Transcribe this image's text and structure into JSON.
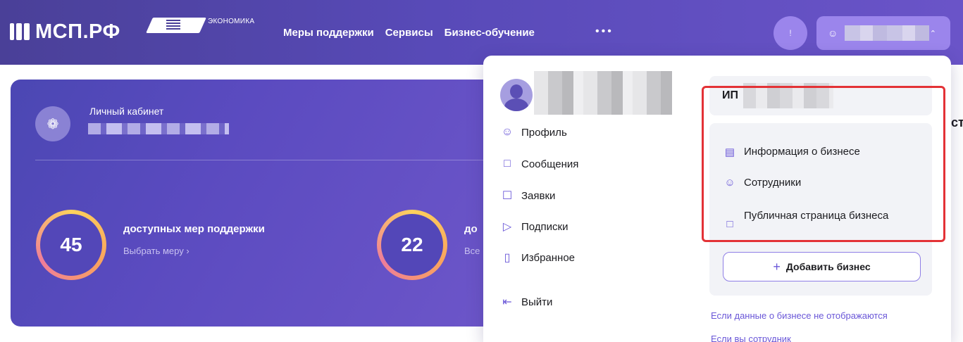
{
  "header": {
    "logo_text": "МСП.РФ",
    "project_label": "ЭКОНОМИКА",
    "nav_items": [
      "Меры поддержки",
      "Сервисы",
      "Бизнес-обучение"
    ],
    "more_label": "•••",
    "notification_label": "!",
    "user_chevron": "⌃"
  },
  "cabinet": {
    "title": "Личный кабинет",
    "stat1": {
      "number": "45",
      "title": "доступных мер поддержки",
      "link": "Выбрать меру ›"
    },
    "stat2": {
      "number": "22",
      "title": "до",
      "link": "Все"
    }
  },
  "profile_menu": {
    "items": [
      {
        "label": "Профиль",
        "icon": "profile-icon"
      },
      {
        "label": "Сообщения",
        "icon": "messages-icon"
      },
      {
        "label": "Заявки",
        "icon": "requests-icon"
      },
      {
        "label": "Подписки",
        "icon": "subscriptions-icon"
      },
      {
        "label": "Избранное",
        "icon": "bookmark-icon"
      }
    ],
    "logout": "Выйти"
  },
  "business": {
    "prefix": "ИП",
    "items": [
      {
        "label": "Информация о бизнесе",
        "icon": "briefcase-icon"
      },
      {
        "label": "Сотрудники",
        "icon": "add-user-icon"
      },
      {
        "label": "Публичная страница бизнеса",
        "icon": "page-icon"
      }
    ],
    "add_button": "Добавить бизнес",
    "links": [
      "Если данные о бизнесе не отображаются",
      "Если вы сотрудник"
    ]
  },
  "edge_text": "ст",
  "colors": {
    "accent": "#6a57d8",
    "header": "#584ab8",
    "highlight": "#e33236"
  }
}
